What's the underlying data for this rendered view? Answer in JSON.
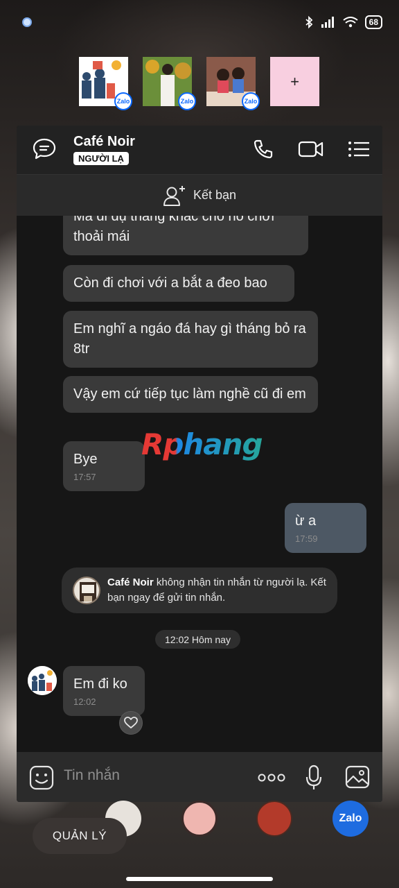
{
  "status": {
    "battery": "68"
  },
  "bubbles": {
    "add_label": "+",
    "badge_label": "Zalo"
  },
  "header": {
    "title": "Café Noir",
    "tag": "NGƯỜI LẠ"
  },
  "friend_bar": {
    "label": "Kết bạn"
  },
  "messages": [
    {
      "text": "Mà đi đụ thằng khác cho nó chơi thoải mái"
    },
    {
      "text": "Còn đi chơi với a bắt a đeo bao"
    },
    {
      "text": "Em nghĩ a ngáo đá hay gì tháng bỏ ra 8tr"
    },
    {
      "text": "Vậy em cứ tiếp tục làm nghề cũ đi em"
    },
    {
      "text": "Bye",
      "time": "17:57"
    },
    {
      "text": "ừ a",
      "time": "17:59",
      "mine": true
    },
    {
      "text": "Em đi ko",
      "time": "12:02"
    }
  ],
  "notice": {
    "name": "Café Noir",
    "text": " không nhận tin nhắn từ người lạ. Kết bạn ngay để gửi tin nhắn."
  },
  "date_divider": "12:02 Hôm nay",
  "composer": {
    "placeholder": "Tin nhắn"
  },
  "watermark": "Rphang",
  "dock": {
    "manage_label": "QUẢN LÝ",
    "zalo_label": "Zalo"
  }
}
